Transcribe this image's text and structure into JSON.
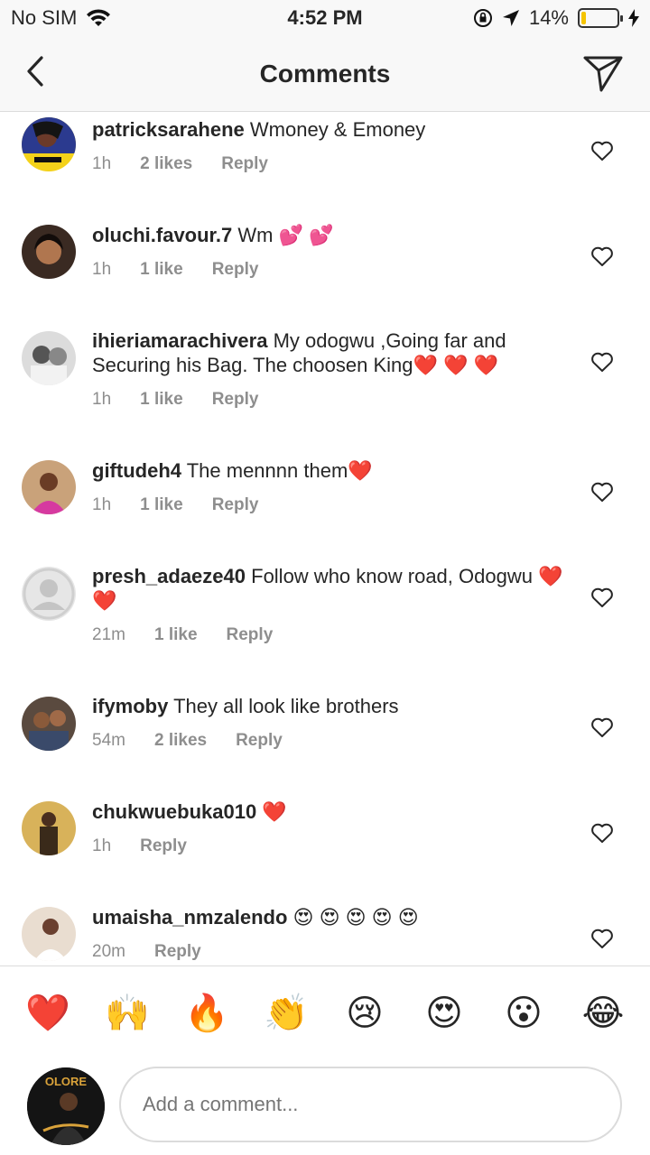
{
  "status_bar": {
    "carrier": "No SIM",
    "time": "4:52 PM",
    "battery_percent_text": "14%",
    "battery_level": 0.14
  },
  "nav": {
    "title": "Comments"
  },
  "comments": [
    {
      "user": "patricksarahene",
      "text": "Wmoney & Emoney",
      "time": "1h",
      "likes": "2 likes",
      "reply": "Reply"
    },
    {
      "user": "oluchi.favour.7",
      "text": "Wm 💕 💕",
      "time": "1h",
      "likes": "1 like",
      "reply": "Reply"
    },
    {
      "user": "ihieriamarachivera",
      "text": "My odogwu ,Going far and Securing his Bag. The choosen King❤️ ❤️ ❤️",
      "time": "1h",
      "likes": "1 like",
      "reply": "Reply"
    },
    {
      "user": "giftudeh4",
      "text": "The mennnn them❤️",
      "time": "1h",
      "likes": "1 like",
      "reply": "Reply"
    },
    {
      "user": "presh_adaeze40",
      "text": "Follow who know road, Odogwu ❤️❤️",
      "time": "21m",
      "likes": "1 like",
      "reply": "Reply"
    },
    {
      "user": "ifymoby",
      "text": "They all look like brothers",
      "time": "54m",
      "likes": "2 likes",
      "reply": "Reply"
    },
    {
      "user": "chukwuebuka010",
      "text": "❤️",
      "time": "1h",
      "likes": "",
      "reply": "Reply"
    },
    {
      "user": "umaisha_nmzalendo",
      "text": "😍 😍 😍 😍 😍",
      "time": "20m",
      "likes": "",
      "reply": "Reply"
    }
  ],
  "emoji_bar": [
    "❤️",
    "🙌",
    "🔥",
    "👏",
    "😢",
    "😍",
    "😮",
    "😂"
  ],
  "composer": {
    "placeholder": "Add a comment...",
    "avatar_text": "OLORE"
  },
  "colors": {
    "text": "#262626",
    "meta": "#8e8e8e",
    "divider": "#dbdbdb",
    "battery": "#f5c400"
  }
}
